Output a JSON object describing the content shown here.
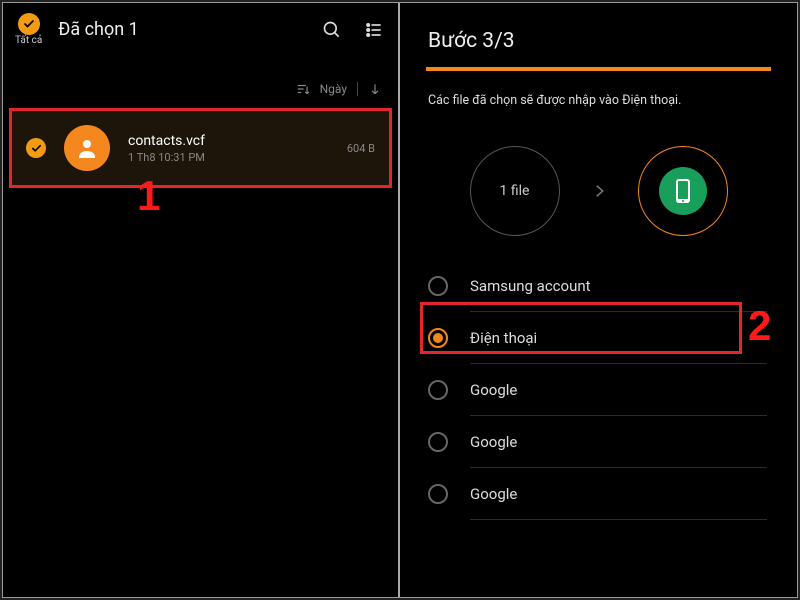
{
  "left": {
    "select_all_label": "Tất cả",
    "title": "Đã chọn 1",
    "sort_label": "Ngày",
    "file": {
      "name": "contacts.vcf",
      "date": "1 Th8 10:31 PM",
      "size": "604 B"
    }
  },
  "right": {
    "step_title": "Bước 3/3",
    "description": "Các file đã chọn sẽ được nhập vào Điện thoại.",
    "source_label": "1 file",
    "options": [
      {
        "label": "Samsung account",
        "selected": false
      },
      {
        "label": "Điện thoại",
        "selected": true
      },
      {
        "label": "Google",
        "selected": false
      },
      {
        "label": "Google",
        "selected": false
      },
      {
        "label": "Google",
        "selected": false
      }
    ]
  },
  "annotations": {
    "one": "1",
    "two": "2"
  }
}
